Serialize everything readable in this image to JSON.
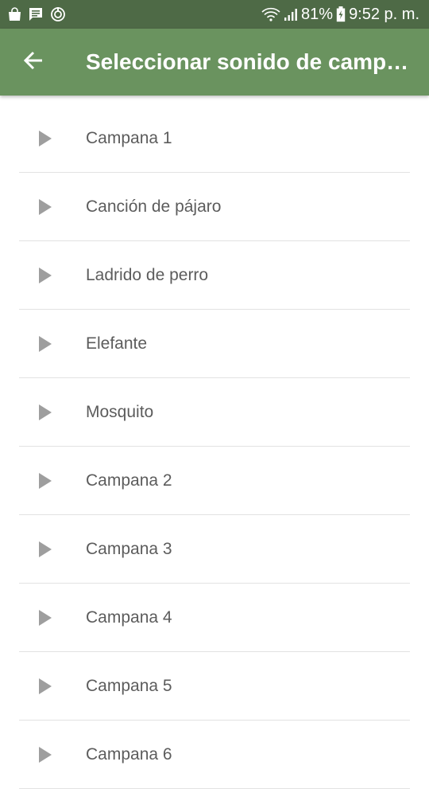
{
  "status_bar": {
    "battery": "81%",
    "time": "9:52 p. m.",
    "icons": [
      "shopping-bag-icon",
      "message-icon",
      "sync-icon",
      "wifi-icon",
      "signal-icon",
      "battery-charging-icon"
    ]
  },
  "app_bar": {
    "back_icon": "arrow-back-icon",
    "title": "Seleccionar sonido de campana"
  },
  "colors": {
    "status_bar": "#4e6a46",
    "app_bar": "#6a935f",
    "play_icon": "#9e9e9e",
    "item_text": "#5c5c5c"
  },
  "sounds": [
    {
      "label": "Campana 1"
    },
    {
      "label": "Canción de pájaro"
    },
    {
      "label": "Ladrido de perro"
    },
    {
      "label": "Elefante"
    },
    {
      "label": "Mosquito"
    },
    {
      "label": "Campana 2"
    },
    {
      "label": "Campana 3"
    },
    {
      "label": "Campana 4"
    },
    {
      "label": "Campana 5"
    },
    {
      "label": "Campana 6"
    }
  ]
}
